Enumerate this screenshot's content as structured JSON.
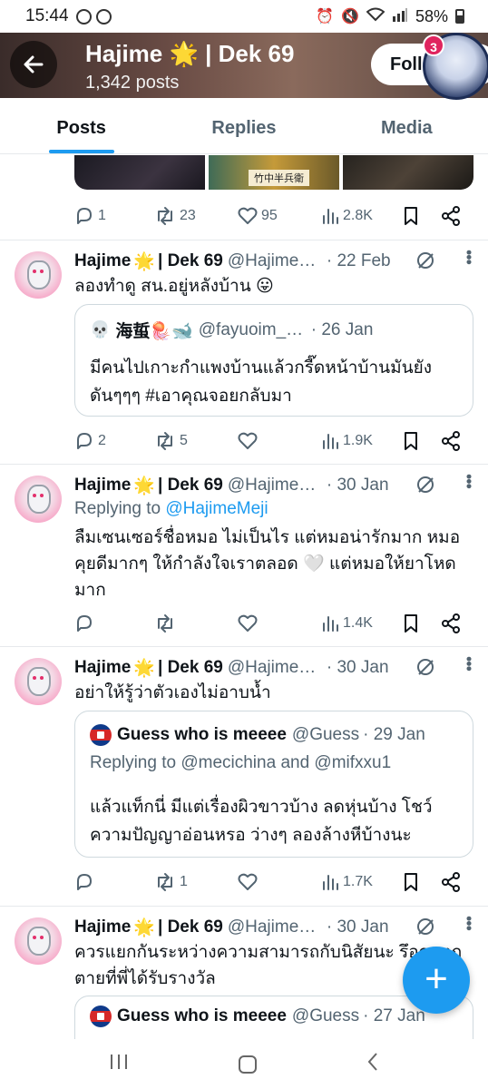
{
  "status_bar": {
    "time": "15:44",
    "battery": "58%"
  },
  "header": {
    "title": "Hajime 🌟 | Dek 69",
    "posts_count": "1,342 posts",
    "follow_label": "Foll",
    "notification_count": "3"
  },
  "tabs": [
    {
      "label": "Posts",
      "active": true
    },
    {
      "label": "Replies",
      "active": false
    },
    {
      "label": "Media",
      "active": false
    }
  ],
  "media_strip": {
    "caption": "竹中半兵衛"
  },
  "first_actions": {
    "replies": "1",
    "reposts": "23",
    "likes": "95",
    "views": "2.8K"
  },
  "posts": [
    {
      "name": "Hajime",
      "name_suffix": "| Dek 69",
      "handle": "@HajimeMeji",
      "date": "· 22 Feb",
      "text": "ลองทำดู สน.อยู่หลังบ้าน 😛",
      "quote": {
        "name": "海蜇🪼🐋",
        "handle": "@fayuoim_yinjing",
        "date": "· 26 Jan",
        "text": "มีคนไปเกาะกำแพงบ้านแล้วกรี๊ดหน้าบ้านมันยังดันๆๆๆ #เอาคุณจอยกลับมา"
      },
      "actions": {
        "replies": "2",
        "reposts": "5",
        "likes": "",
        "views": "1.9K"
      }
    },
    {
      "name": "Hajime",
      "name_suffix": "| Dek 69",
      "handle": "@HajimeMeji",
      "date": "· 30 Jan",
      "replying_prefix": "Replying to ",
      "replying_to": "@HajimeMeji",
      "text": "ลืมเซนเซอร์ชื่อหมอ ไม่เป็นไร แต่หมอน่ารักมาก หมอคุยดีมากๆ ให้กำลังใจเราตลอด 🤍 แต่หมอให้ยาโหดมาก",
      "actions": {
        "replies": "",
        "reposts": "",
        "likes": "",
        "views": "1.4K"
      }
    },
    {
      "name": "Hajime",
      "name_suffix": "| Dek 69",
      "handle": "@HajimeMeji",
      "date": "· 30 Jan",
      "text": "อย่าให้รู้ว่าตัวเองไม่อาบน้ำ",
      "quote": {
        "name": "Guess who is meeee",
        "handle": "@Guess",
        "date": "· 29 Jan",
        "replying": "Replying to @mecichina and @mifxxu1",
        "text": "แล้วแท็กนี่ มีแต่เรื่องผิวขาวบ้าง ลดหุ่นบ้าง โชว์ความปัญญาอ่อนหรอ ว่างๆ ลองล้างหีบ้างนะ"
      },
      "actions": {
        "replies": "",
        "reposts": "1",
        "likes": "",
        "views": "1.7K"
      }
    },
    {
      "name": "Hajime",
      "name_suffix": "| Dek 69",
      "handle": "@HajimeMeji",
      "date": "· 30 Jan",
      "text": "ควรแยกกันระหว่างความสามารถกับนิสัยนะ รึอกแตกตายที่พี่ได้รับรางวัล",
      "quote": {
        "name": "Guess who is meeee",
        "handle": "@Guess",
        "date": "· 27 Jan"
      }
    }
  ],
  "fab": {
    "label": "+"
  },
  "colors": {
    "accent": "#1d9bf0",
    "text": "#0f1419",
    "muted": "#536471",
    "badge": "#e0245e"
  }
}
